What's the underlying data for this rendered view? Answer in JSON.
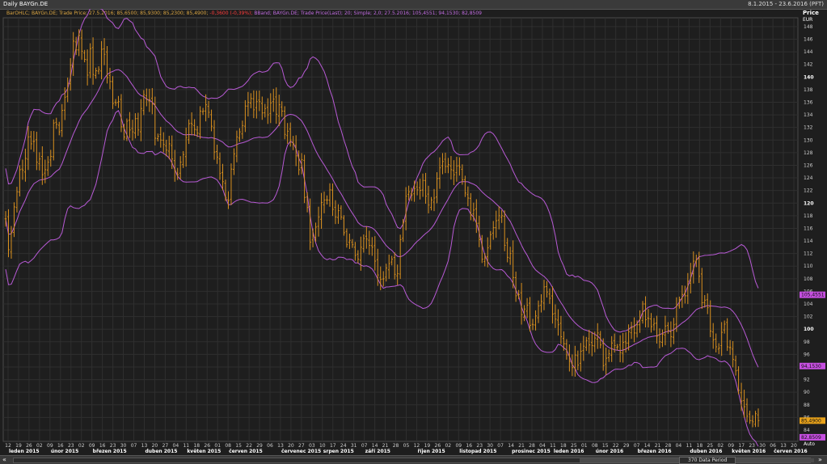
{
  "window": {
    "title": "Daily BAYGn.DE",
    "range": "8.1.2015 - 23.6.2016 (PFT)"
  },
  "legend": {
    "ohlc": "BarOHLC; BAYGn.DE; Trade Price;  27.5.2016; 85,6500; 85,9300; 85,2300; 85,4900;",
    "change": " -0,3600 (-0,39%);",
    "bband": " BBand; BAYGn.DE; Trade Price(Last);  20; Simple; 2,0;  27.5.2016; 105,4551; 94,1530; 82,8509"
  },
  "axis": {
    "title": "Price",
    "unit": "EUR",
    "ticks": [
      "84",
      "86",
      "88",
      "90",
      "92",
      "94",
      "96",
      "98",
      "100",
      "102",
      "104",
      "106",
      "108",
      "110",
      "112",
      "114",
      "116",
      "118",
      "120",
      "122",
      "124",
      "126",
      "128",
      "130",
      "132",
      "134",
      "136",
      "138",
      "140",
      "142",
      "144",
      "146",
      "148"
    ],
    "bold_ticks": [
      "100",
      "120",
      "140"
    ],
    "tag_upper": "105,4551",
    "tag_middle": "94,1530",
    "tag_price": "85,4900",
    "tag_lower": "82,8509",
    "auto_label": "Auto"
  },
  "bottom": {
    "period_label": "370 Data Period",
    "nav_left": "«",
    "nav_right": "»"
  },
  "colors": {
    "background": "#1e1e1e",
    "grid": "#2f2f2f",
    "bars": "#d9901e",
    "band": "#b85ad6",
    "tag_band": "#c64fe0",
    "tag_price": "#e8a21a",
    "negative": "#ff3b3b"
  },
  "chart_data": {
    "type": "ohlc",
    "title": "Daily BAYGn.DE",
    "ylabel": "Price EUR",
    "ylim": [
      82.2,
      149.4
    ],
    "x_start": "2015-01-08",
    "x_end": "2016-06-23",
    "last_bar": {
      "date": "2016-05-27",
      "open": 85.65,
      "high": 85.93,
      "low": 85.23,
      "close": 85.49
    },
    "bollinger": {
      "period": 20,
      "type": "Simple",
      "stddev": 2.0,
      "upper": 105.4551,
      "middle": 94.153,
      "lower": 82.8509
    },
    "x_tick_days": [
      "12",
      "19",
      "26",
      "02",
      "09",
      "16",
      "23",
      "02",
      "09",
      "16",
      "23",
      "30",
      "07",
      "13",
      "20",
      "27",
      "04",
      "11",
      "18",
      "26",
      "01",
      "08",
      "15",
      "22",
      "29",
      "06",
      "13",
      "20",
      "27",
      "03",
      "10",
      "17",
      "24",
      "31",
      "07",
      "14",
      "21",
      "28",
      "05",
      "12",
      "19",
      "26",
      "02",
      "09",
      "16",
      "23",
      "30",
      "07",
      "14",
      "21",
      "28",
      "04",
      "11",
      "18",
      "25",
      "01",
      "08",
      "15",
      "22",
      "29",
      "07",
      "14",
      "21",
      "28",
      "04",
      "11",
      "18",
      "25",
      "02",
      "09",
      "17",
      "23",
      "30",
      "06",
      "13",
      "20"
    ],
    "x_months": [
      "leden 2015",
      "únor 2015",
      "březen 2015",
      "duben 2015",
      "květen 2015",
      "červen 2015",
      "červenec 2015",
      "srpen 2015",
      "září 2015",
      "říjen 2015",
      "listopad 2015",
      "prosinec 2015",
      "leden 2016",
      "únor 2016",
      "březen 2016",
      "duben 2016",
      "květen 2016",
      "červen 2016"
    ],
    "close_series": [
      117.5,
      112.6,
      115.3,
      119.4,
      121.8,
      125.3,
      125.2,
      127.1,
      130.5,
      129.4,
      129.8,
      126.5,
      127,
      124.5,
      125.3,
      126.5,
      127.4,
      132.7,
      132.5,
      131.3,
      134.7,
      136.8,
      139,
      141.9,
      145.7,
      144.3,
      146.6,
      144.1,
      142.8,
      140.3,
      144.5,
      140.4,
      141,
      141.2,
      144.4,
      143.6,
      139.9,
      139.3,
      135.8,
      135.9,
      136.1,
      132.1,
      130.5,
      133,
      131.6,
      131.3,
      133.4,
      131.6,
      135,
      137.2,
      136.5,
      136.4,
      135.7,
      130.3,
      130.6,
      130,
      129.3,
      128.4,
      129.4,
      127,
      125.1,
      124.5,
      126.5,
      127.7,
      130.4,
      132.6,
      132.5,
      131.7,
      131.1,
      134.6,
      134.6,
      135.6,
      134.4,
      132.2,
      128.1,
      127.3,
      124.7,
      123.4,
      120.9,
      120.4,
      125.4,
      127.8,
      130.5,
      131.3,
      132.3,
      135.4,
      136,
      136.6,
      134.8,
      136.1,
      136.1,
      134.3,
      135,
      134,
      135.9,
      136.5,
      134.1,
      135.6,
      134.6,
      130.9,
      131.4,
      130,
      129.4,
      127.5,
      125.3,
      126.9,
      120.9,
      119.3,
      113.8,
      114.8,
      116.2,
      117.8,
      120.1,
      120.5,
      120.5,
      122.1,
      119,
      117.8,
      118.8,
      117.8,
      115.3,
      113.4,
      114.1,
      113.4,
      111.7,
      111.1,
      113,
      114.4,
      114.3,
      113.3,
      113,
      110.8,
      108.6,
      107.9,
      108,
      109.7,
      110.4,
      111.1,
      108.7,
      108.8,
      114.2,
      116.9,
      121.1,
      121.8,
      121.3,
      122.3,
      122.1,
      122,
      123.6,
      121.1,
      119.7,
      120.5,
      120.8,
      123.9,
      125.6,
      126.6,
      125.8,
      126.1,
      125.3,
      124.5,
      125.9,
      125.7,
      123.7,
      121.6,
      120.8,
      118.1,
      118.9,
      116.8,
      114.2,
      111.1,
      111.3,
      112.9,
      115,
      116.1,
      117.2,
      118,
      118,
      113.3,
      111.4,
      112,
      108.2,
      105.3,
      105.5,
      102.3,
      103.2,
      103.8,
      100.6,
      100.7,
      102.1,
      103.7,
      104.4,
      106.7,
      105.9,
      104.9,
      102.4,
      101.6,
      100.7,
      98.8,
      97.7,
      95.9,
      94.9,
      93.9,
      95.9,
      94.3,
      96.5,
      97.3,
      98.2,
      97.5,
      97.4,
      98.6,
      99.4,
      97.5,
      94.2,
      95.4,
      96.1,
      97.8,
      97.4,
      97.2,
      96.3,
      97.9,
      97.8,
      99.6,
      100.2,
      99.4,
      100.7,
      101.7,
      104,
      101.5,
      101.7,
      100.4,
      100.9,
      98.9,
      98,
      99.2,
      100.5,
      99.8,
      98.8,
      100.7,
      103.8,
      104.7,
      105.5,
      105.3,
      107.6,
      108.9,
      110.8,
      111,
      108.4,
      104.2,
      104.6,
      103.4,
      99.7,
      98.3,
      97.2,
      97,
      99.5,
      100.8,
      97.2,
      97.1,
      95.2,
      93.4,
      90.3,
      88.6,
      87.7,
      86.2,
      85.5,
      85.3,
      86.6,
      85.5
    ]
  }
}
